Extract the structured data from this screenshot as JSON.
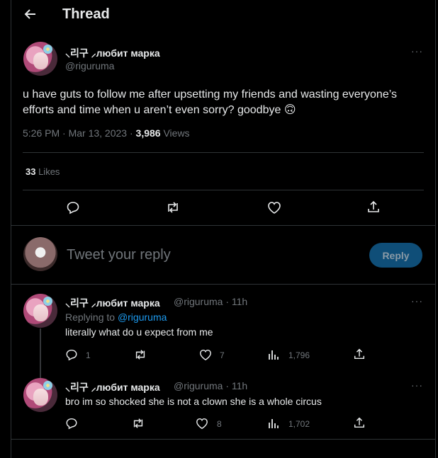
{
  "header": {
    "title": "Thread"
  },
  "tweet": {
    "display_name": "⸜리구 ⸝любит марка",
    "handle": "@riguruma",
    "text": "u have guts to follow me after upsetting my friends and wasting everyone’s efforts and time when u aren’t even sorry? goodbye",
    "emoji": "🙃",
    "time": "5:26 PM · Mar 13, 2023 · ",
    "views_count": "3,986",
    "views_label": " Views",
    "likes_count": "33",
    "likes_label": " Likes"
  },
  "compose": {
    "placeholder": "Tweet your reply",
    "button": "Reply"
  },
  "replies": [
    {
      "display_name": "⸜리구 ⸝любит марка",
      "handle_time": "@riguruma · 11h",
      "replying_prefix": "Replying to ",
      "replying_handle": "@riguruma",
      "text": "literally what do u expect from me",
      "replies": "1",
      "retweets": "",
      "likes": "7",
      "views": "1,796"
    },
    {
      "display_name": "⸜리구 ⸝любит марка",
      "handle_time": "@riguruma · 11h",
      "text": "bro im so shocked she is not a clown she is a whole circus",
      "replies": "",
      "retweets": "",
      "likes": "8",
      "views": "1,702"
    }
  ],
  "more_label": "···",
  "icons": [
    "back-arrow-icon",
    "reply-icon",
    "retweet-icon",
    "like-icon",
    "share-icon",
    "views-icon",
    "more-icon"
  ],
  "colors": {
    "accent": "#1d9bf0",
    "reply_button": "#0f4e78",
    "muted": "#71767b",
    "border": "#2f3336"
  }
}
